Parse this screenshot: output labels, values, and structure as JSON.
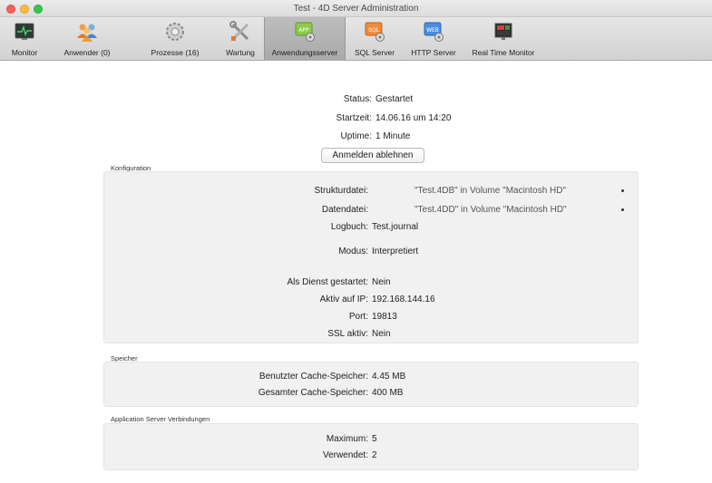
{
  "window": {
    "title": "Test - 4D Server Administration"
  },
  "toolbar": {
    "items": [
      {
        "label": "Monitor",
        "icon": "monitor-icon"
      },
      {
        "label": "Anwender (0)",
        "icon": "users-icon"
      },
      {
        "label": "Prozesse (16)",
        "icon": "processes-gear-icon"
      },
      {
        "label": "Wartung",
        "icon": "maintenance-tools-icon"
      },
      {
        "label": "Anwendungsserver",
        "icon": "app-server-icon"
      },
      {
        "label": "SQL Server",
        "icon": "sql-server-icon"
      },
      {
        "label": "HTTP Server",
        "icon": "http-server-icon"
      },
      {
        "label": "Real Time Monitor",
        "icon": "realtime-monitor-icon"
      }
    ],
    "active_index": 4
  },
  "status": {
    "status_key": "Status:",
    "status_val": "Gestartet",
    "start_key": "Startzeit:",
    "start_val": "14.06.16 um 14:20",
    "uptime_key": "Uptime:",
    "uptime_val": "1 Minute",
    "button_label": "Anmelden ablehnen"
  },
  "config": {
    "label": "Konfiguration",
    "structure_key": "Strukturdatei:",
    "structure_val": "\"Test.4DB\" in Volume \"Macintosh HD\"",
    "data_key": "Datendatei:",
    "data_val": "\"Test.4DD\" in Volume \"Macintosh HD\"",
    "log_key": "Logbuch:",
    "log_val": "Test.journal",
    "mode_key": "Modus:",
    "mode_val": "Interpretiert",
    "service_key": "Als Dienst gestartet:",
    "service_val": "Nein",
    "ip_key": "Aktiv auf IP:",
    "ip_val": "192.168.144.16",
    "port_key": "Port:",
    "port_val": "19813",
    "ssl_key": "SSL aktiv:",
    "ssl_val": "Nein"
  },
  "memory": {
    "label": "Speicher",
    "used_key": "Benutzter Cache-Speicher:",
    "used_val": "4.45 MB",
    "total_key": "Gesamter Cache-Speicher:",
    "total_val": "400 MB"
  },
  "connections": {
    "label": "Application Server Verbindungen",
    "max_key": "Maximum:",
    "max_val": "5",
    "used_key": "Verwendet:",
    "used_val": "2"
  },
  "colors": {
    "accent_green": "#34c84a",
    "active_tab": "#b3b3b3",
    "box_bg": "#f1f1f1"
  }
}
